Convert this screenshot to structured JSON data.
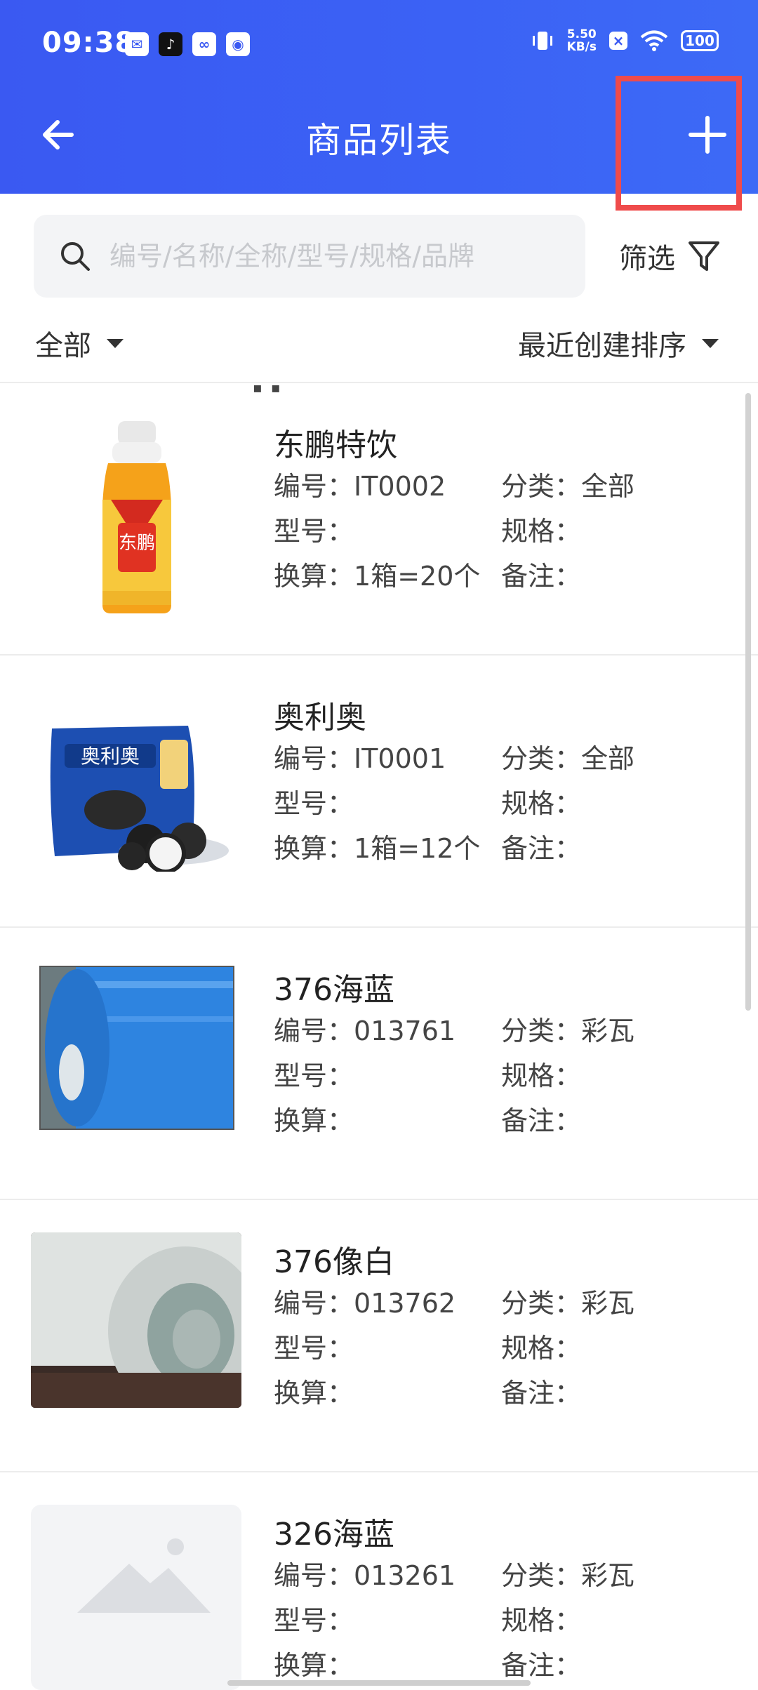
{
  "status_bar": {
    "time": "09:38",
    "net_speed_value": "5.50",
    "net_speed_unit": "KB/s",
    "battery": "100"
  },
  "nav": {
    "title": "商品列表"
  },
  "search": {
    "placeholder": "编号/名称/全称/型号/规格/品牌",
    "filter_label": "筛选"
  },
  "filters": {
    "category": "全部",
    "sort": "最近创建排序"
  },
  "labels": {
    "code": "编号：",
    "category": "分类：",
    "model": "型号：",
    "spec": "规格：",
    "conversion": "换算：",
    "remark": "备注："
  },
  "products": [
    {
      "name": "东鹏特饮",
      "code": "IT0002",
      "category": "全部",
      "model": "",
      "spec": "",
      "conversion": "1箱=20个",
      "remark": "",
      "image": "energy-drink-bottle",
      "bottle_text": "东鹏"
    },
    {
      "name": "奥利奥",
      "code": "IT0001",
      "category": "全部",
      "model": "",
      "spec": "",
      "conversion": "1箱=12个",
      "remark": "",
      "image": "cookie-pack",
      "pack_text": "奥利奥"
    },
    {
      "name": "376海蓝",
      "code": "013761",
      "category": "彩瓦",
      "model": "",
      "spec": "",
      "conversion": "",
      "remark": "",
      "image": "blue-steel-coil"
    },
    {
      "name": "376像白",
      "code": "013762",
      "category": "彩瓦",
      "model": "",
      "spec": "",
      "conversion": "",
      "remark": "",
      "image": "white-steel-coil"
    },
    {
      "name": "326海蓝",
      "code": "013261",
      "category": "彩瓦",
      "model": "",
      "spec": "",
      "conversion": "",
      "remark": "",
      "image": "placeholder-image"
    }
  ],
  "colors": {
    "header": "#3a59f2",
    "highlight": "#ef4b4b"
  }
}
